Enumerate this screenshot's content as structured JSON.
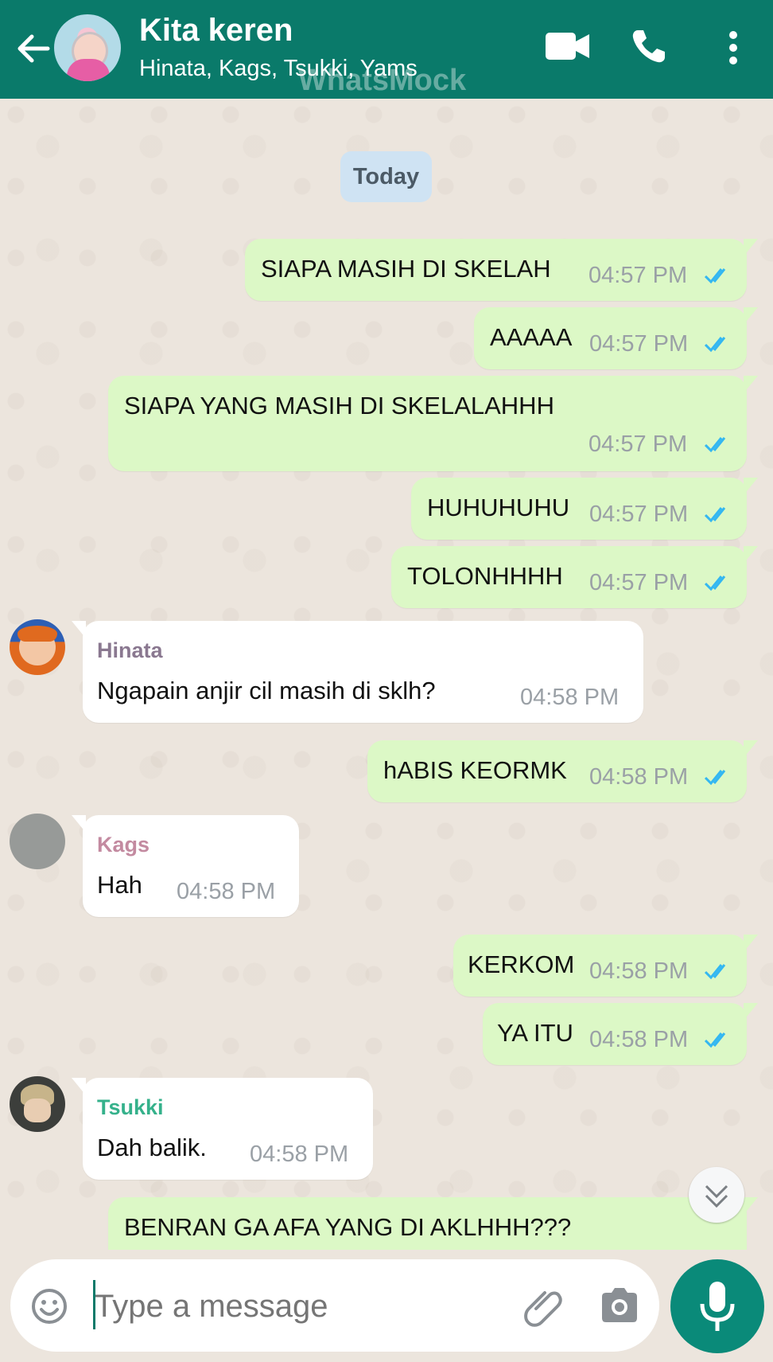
{
  "header": {
    "title": "Kita keren",
    "subtitle": "Hinata, Kags, Tsukki, Yams",
    "watermark": "WhatsMock"
  },
  "date_pill": "Today",
  "messages": [
    {
      "kind": "outgoing",
      "text": "SIAPA MASIH DI SKELAH",
      "time": "04:57 PM",
      "status": "read"
    },
    {
      "kind": "outgoing",
      "text": "AAAAA",
      "time": "04:57 PM",
      "status": "read"
    },
    {
      "kind": "outgoing",
      "text": "SIAPA YANG MASIH DI SKELALAHHH",
      "time": "04:57 PM",
      "status": "read"
    },
    {
      "kind": "outgoing",
      "text": "HUHUHUHU",
      "time": "04:57 PM",
      "status": "read"
    },
    {
      "kind": "outgoing",
      "text": "TOLONHHHH",
      "time": "04:57 PM",
      "status": "read"
    },
    {
      "kind": "incoming",
      "sender": "Hinata",
      "text": "Ngapain anjir cil masih di sklh?",
      "time": "04:58 PM"
    },
    {
      "kind": "outgoing",
      "text": "hABIS KEORMK",
      "time": "04:58 PM",
      "status": "read"
    },
    {
      "kind": "incoming",
      "sender": "Kags",
      "text": "Hah",
      "time": "04:58 PM"
    },
    {
      "kind": "outgoing",
      "text": "KERKOM",
      "time": "04:58 PM",
      "status": "read"
    },
    {
      "kind": "outgoing",
      "text": "YA ITU",
      "time": "04:58 PM",
      "status": "read"
    },
    {
      "kind": "incoming",
      "sender": "Tsukki",
      "text": "Dah balik.",
      "time": "04:58 PM"
    },
    {
      "kind": "outgoing",
      "text": "BENRAN GA AFA YANG DI AKLHHH???",
      "time": "",
      "status": ""
    }
  ],
  "composer": {
    "placeholder": "Type a message"
  },
  "icons": {
    "back": "arrow-left-icon",
    "video": "video-call-icon",
    "call": "phone-icon",
    "menu": "more-vert-icon",
    "emoji": "emoji-icon",
    "attach": "paperclip-icon",
    "camera": "camera-icon",
    "mic": "microphone-icon",
    "scroll": "chevrons-down-icon"
  },
  "colors": {
    "header": "#0a7a6a",
    "outgoing_bubble": "#dcf8c6",
    "incoming_bubble": "#ffffff",
    "read_ticks": "#34b7f1",
    "hinata_name": "#8a7890",
    "kags_name": "#c38aa0",
    "tsukki_name": "#35b18b"
  }
}
